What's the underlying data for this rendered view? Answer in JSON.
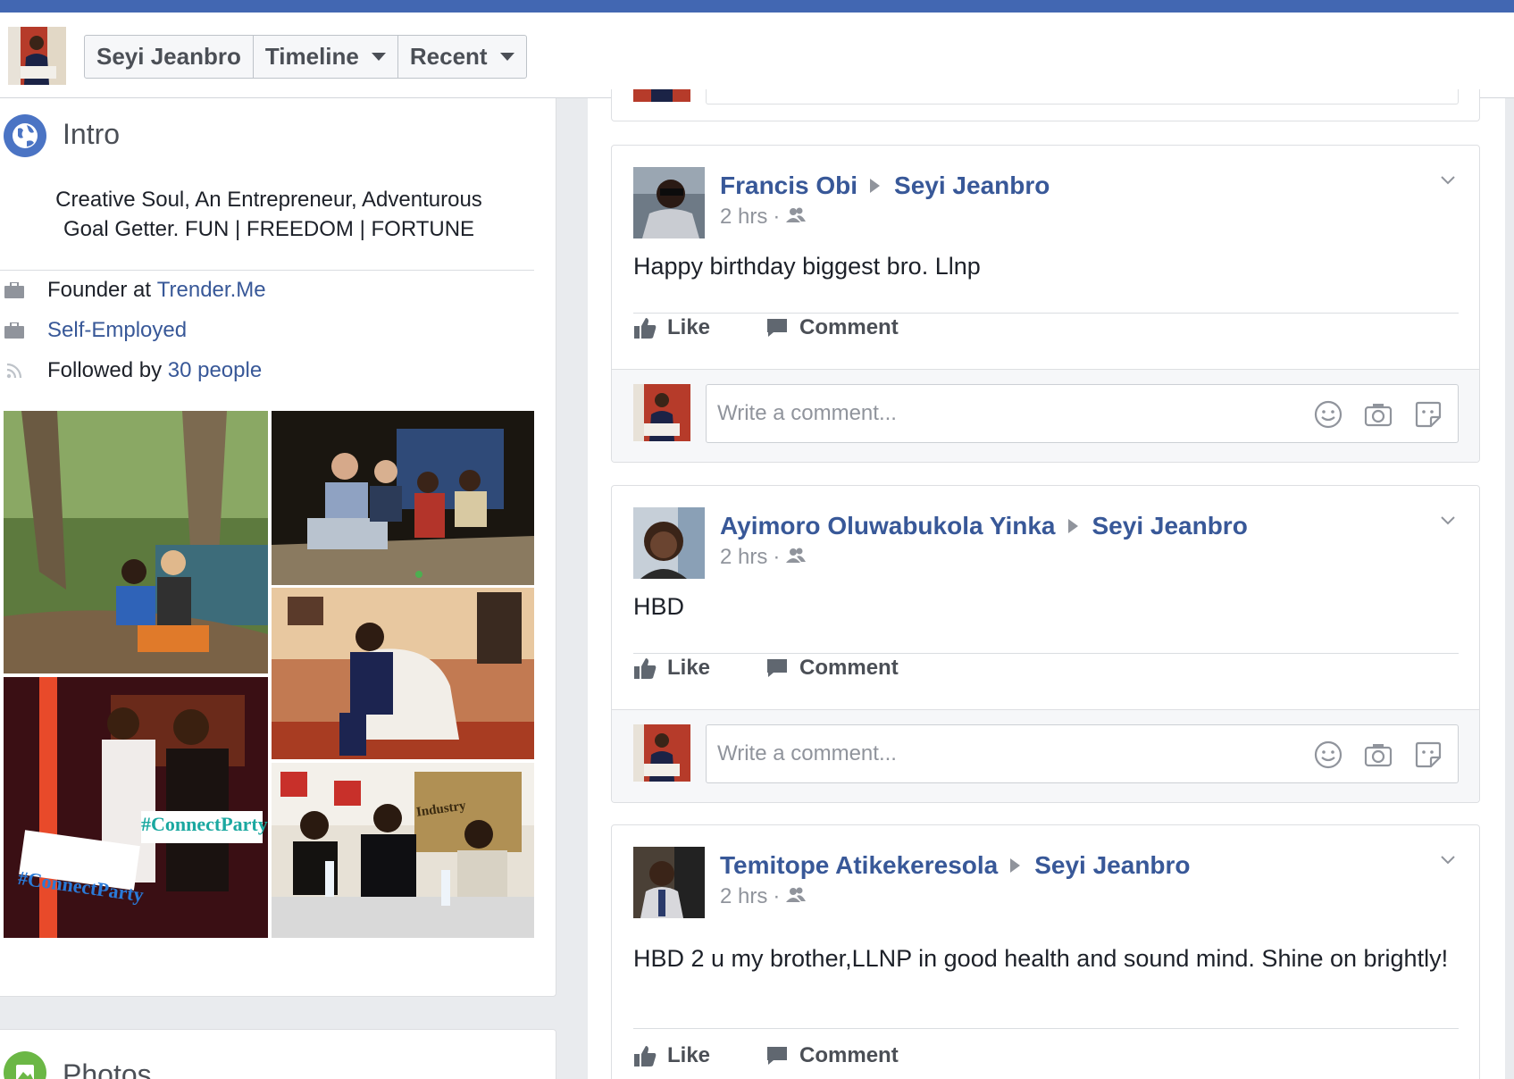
{
  "header": {
    "nav": [
      {
        "label": "Seyi Jeanbro",
        "has_caret": false
      },
      {
        "label": "Timeline",
        "has_caret": true
      },
      {
        "label": "Recent",
        "has_caret": true
      }
    ]
  },
  "intro": {
    "title": "Intro",
    "bio_line1": "Creative Soul, An Entrepreneur, Adventurous",
    "bio_line2": "Goal Getter. FUN | FREEDOM | FORTUNE",
    "founder_prefix": "Founder at ",
    "founder_link": "Trender.Me",
    "employment": "Self-Employed",
    "followed_prefix": "Followed by ",
    "followed_link": "30 people"
  },
  "photos_section": {
    "title": "Photos"
  },
  "photo_tags": {
    "tag1": "#ConnectParty",
    "tag2": "#ConnectParty",
    "sign": "Industry"
  },
  "posts": [
    {
      "author": "Francis Obi",
      "target": "Seyi Jeanbro",
      "time": "2 hrs",
      "text": "Happy birthday biggest bro. Llnp",
      "like": "Like",
      "comment": "Comment",
      "comment_placeholder": "Write a comment..."
    },
    {
      "author": "Ayimoro Oluwabukola Yinka",
      "target": "Seyi Jeanbro",
      "time": "2 hrs",
      "text": "HBD",
      "like": "Like",
      "comment": "Comment",
      "comment_placeholder": "Write a comment..."
    },
    {
      "author": "Temitope Atikekeresola",
      "target": "Seyi Jeanbro",
      "time": "2 hrs",
      "text": "HBD 2 u my brother,LLNP in good health and sound mind. Shine on brightly!",
      "like": "Like",
      "comment": "Comment"
    }
  ],
  "colors": {
    "brand_blue": "#4267b2",
    "link_blue": "#385898",
    "meta_grey": "#90949c"
  }
}
